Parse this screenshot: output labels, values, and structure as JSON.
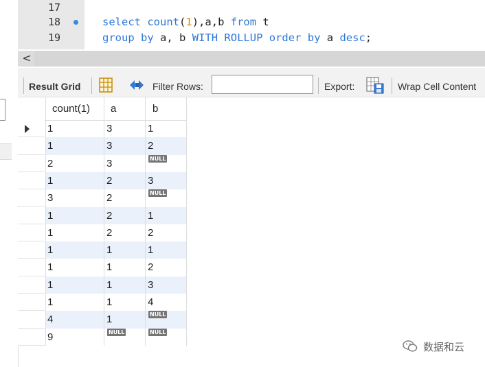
{
  "editor": {
    "lines": [
      {
        "number": "17",
        "code": "",
        "breakpoint": false
      },
      {
        "number": "18",
        "code": "select count(1),a,b from t",
        "breakpoint": true
      },
      {
        "number": "19",
        "code": "group by a, b WITH ROLLUP order by a desc;",
        "breakpoint": false
      }
    ]
  },
  "scrollbar": {
    "left_arrow": "<"
  },
  "toolbar": {
    "result_grid_label": "Result Grid",
    "filter_rows_label": "Filter Rows:",
    "filter_value": "",
    "export_label": "Export:",
    "wrap_label": "Wrap Cell Content",
    "icons": [
      "grid-layout-icon",
      "refresh-icon",
      "export-file-icon"
    ]
  },
  "grid": {
    "columns": [
      "count(1)",
      "a",
      "b"
    ],
    "null_badge": "NULL",
    "rows": [
      [
        "1",
        "3",
        "1"
      ],
      [
        "1",
        "3",
        "2"
      ],
      [
        "2",
        "3",
        "NULL"
      ],
      [
        "1",
        "2",
        "3"
      ],
      [
        "3",
        "2",
        "NULL"
      ],
      [
        "1",
        "2",
        "1"
      ],
      [
        "1",
        "2",
        "2"
      ],
      [
        "1",
        "1",
        "1"
      ],
      [
        "1",
        "1",
        "2"
      ],
      [
        "1",
        "1",
        "3"
      ],
      [
        "1",
        "1",
        "4"
      ],
      [
        "4",
        "1",
        "NULL"
      ],
      [
        "9",
        "NULL",
        "NULL"
      ]
    ],
    "selected_row": 0
  },
  "watermark": {
    "text": "数据和云",
    "icon": "wechat-icon"
  },
  "colors": {
    "keyword": "#2b78d6",
    "number": "#e88a00",
    "null_badge": "#757575",
    "alt_row": "#ebf1fb"
  }
}
